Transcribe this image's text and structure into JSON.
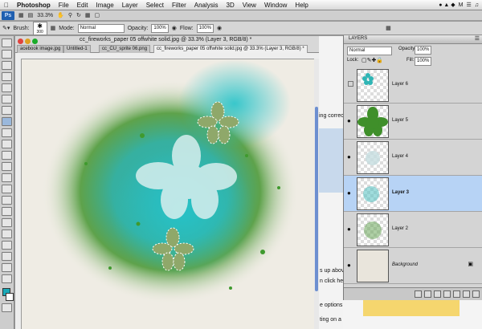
{
  "menubar": {
    "app": "Photoshop",
    "items": [
      "File",
      "Edit",
      "Image",
      "Layer",
      "Select",
      "Filter",
      "Analysis",
      "3D",
      "View",
      "Window",
      "Help"
    ],
    "right_label": "M"
  },
  "appbar": {
    "logo": "Ps",
    "zoom": "33.3%"
  },
  "options": {
    "brush_label": "Brush:",
    "brush_size": "300",
    "mode_label": "Mode:",
    "mode_value": "Normal",
    "opacity_label": "Opacity:",
    "opacity_value": "100%",
    "flow_label": "Flow:",
    "flow_value": "100%"
  },
  "document": {
    "title": "cc_fireworks_paper 05 offwhite solid.jpg @ 33.3% (Layer 3, RGB/8) *",
    "tabs": [
      "acebook image.jpg",
      "Untitled-1",
      "cc_CU_sprite 06.png",
      "cc_fireworks_paper 05 offwhite solid.jpg @ 33.3% (Layer 3, RGB/8) *"
    ]
  },
  "background_doc": {
    "snippets": [
      "ing correctly",
      "s up above",
      "n click he",
      "e options",
      "ting on a bit"
    ]
  },
  "layers": {
    "title": "LAYERS",
    "blend_mode": "Normal",
    "opacity_label": "Opacity:",
    "opacity_value": "100%",
    "lock_label": "Lock:",
    "fill_label": "Fill:",
    "fill_value": "100%",
    "items": [
      {
        "name": "Layer 6",
        "visible": false
      },
      {
        "name": "Layer 5",
        "visible": true
      },
      {
        "name": "Layer 4",
        "visible": true
      },
      {
        "name": "Layer 3",
        "visible": true,
        "selected": true
      },
      {
        "name": "Layer 2",
        "visible": true
      },
      {
        "name": "Background",
        "visible": true
      }
    ]
  },
  "colors": {
    "accent_blue": "#b7d3f5",
    "teal": "#2fb5b5",
    "green": "#3f9a2e",
    "paper": "#efece4"
  }
}
